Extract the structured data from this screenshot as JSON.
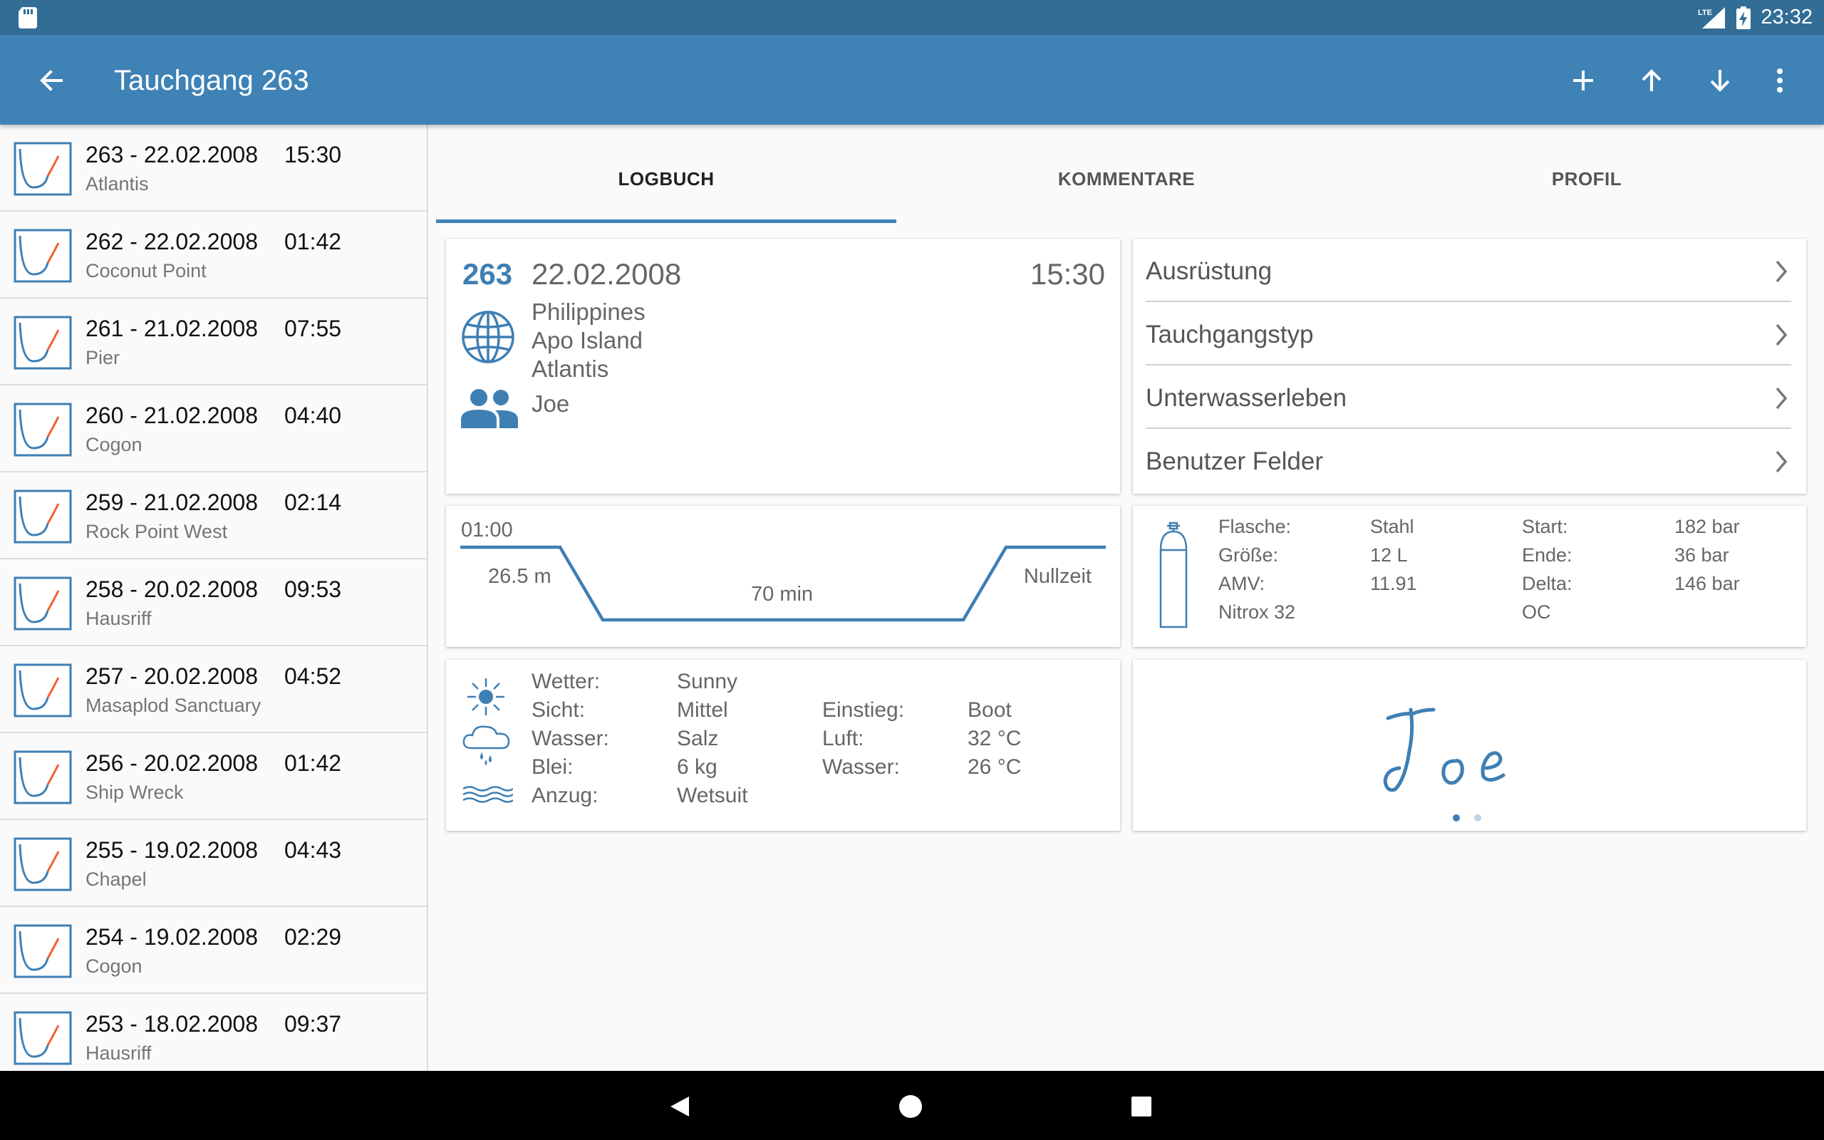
{
  "status": {
    "time": "23:32",
    "network": "LTE"
  },
  "appbar": {
    "title": "Tauchgang 263"
  },
  "dives": [
    {
      "title": "263 - 22.02.2008",
      "time": "15:30",
      "site": "Atlantis"
    },
    {
      "title": "262 - 22.02.2008",
      "time": "01:42",
      "site": "Coconut Point"
    },
    {
      "title": "261 - 21.02.2008",
      "time": "07:55",
      "site": "Pier"
    },
    {
      "title": "260 - 21.02.2008",
      "time": "04:40",
      "site": "Cogon"
    },
    {
      "title": "259 - 21.02.2008",
      "time": "02:14",
      "site": "Rock Point West"
    },
    {
      "title": "258 - 20.02.2008",
      "time": "09:53",
      "site": "Hausriff"
    },
    {
      "title": "257 - 20.02.2008",
      "time": "04:52",
      "site": "Masaplod Sanctuary"
    },
    {
      "title": "256 - 20.02.2008",
      "time": "01:42",
      "site": "Ship Wreck"
    },
    {
      "title": "255 - 19.02.2008",
      "time": "04:43",
      "site": "Chapel"
    },
    {
      "title": "254 - 19.02.2008",
      "time": "02:29",
      "site": "Cogon"
    },
    {
      "title": "253 - 18.02.2008",
      "time": "09:37",
      "site": "Hausriff"
    }
  ],
  "tabs": [
    "LOGBUCH",
    "KOMMENTARE",
    "PROFIL"
  ],
  "summary": {
    "number": "263",
    "date": "22.02.2008",
    "time": "15:30",
    "country": "Philippines",
    "region": "Apo Island",
    "site": "Atlantis",
    "buddy": "Joe"
  },
  "nav": [
    "Ausrüstung",
    "Tauchgangstyp",
    "Unterwasserleben",
    "Benutzer Felder"
  ],
  "profile": {
    "surface_interval": "01:00",
    "depth": "26.5 m",
    "duration": "70 min",
    "deco": "Nullzeit"
  },
  "tank": {
    "labels1": [
      "Flasche:",
      "Größe:",
      "AMV:"
    ],
    "values1": [
      "Stahl",
      "12 L",
      "11.91"
    ],
    "gas": "Nitrox 32",
    "labels2": [
      "Start:",
      "Ende:",
      "Delta:"
    ],
    "values2": [
      "182 bar",
      "36 bar",
      "146 bar"
    ],
    "mode": "OC"
  },
  "conditions": {
    "labels1": [
      "Wetter:",
      "Sicht:",
      "Wasser:",
      "Blei:",
      "Anzug:"
    ],
    "values1": [
      "Sunny",
      "Mittel",
      "Salz",
      "6 kg",
      "Wetsuit"
    ],
    "labels2": [
      "Einstieg:",
      "Luft:",
      "Wasser:"
    ],
    "values2": [
      "Boot",
      "32 °C",
      "26 °C"
    ]
  },
  "signature": {
    "name": "Joe",
    "pages": 2,
    "current_page": 1
  },
  "colors": {
    "primary": "#3f82b6",
    "statusbar": "#326d96",
    "accent_blue": "#3e7fb4",
    "profile_red": "#f0602e"
  }
}
